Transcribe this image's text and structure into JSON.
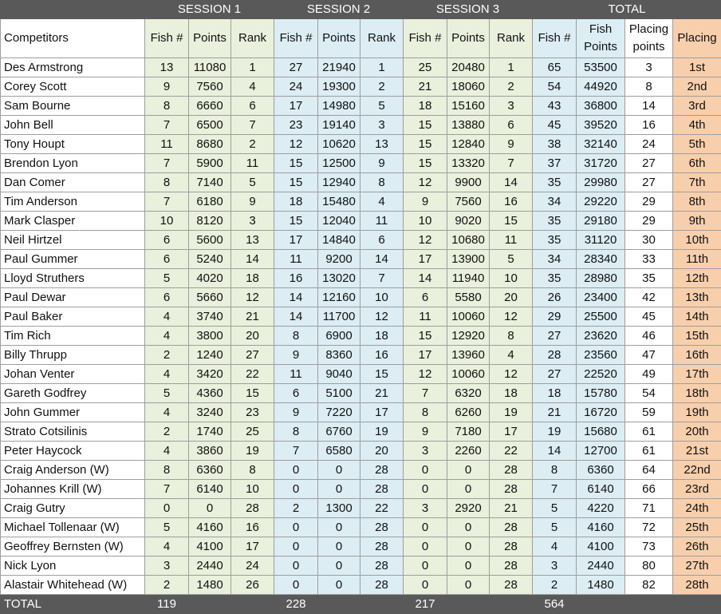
{
  "sessions": [
    "SESSION 1",
    "SESSION 2",
    "SESSION 3",
    "TOTAL"
  ],
  "headers": {
    "competitors": "Competitors",
    "fish": "Fish #",
    "points": "Points",
    "rank": "Rank",
    "total_fish": "Fish #",
    "fish_points": "Fish Points",
    "placing_points": "Placing points",
    "placing": "Placing"
  },
  "rows": [
    {
      "name": "Des Armstrong",
      "s1": [
        "13",
        "11080",
        "1"
      ],
      "s2": [
        "27",
        "21940",
        "1"
      ],
      "s3": [
        "25",
        "20480",
        "1"
      ],
      "total": [
        "65",
        "53500",
        "3",
        "1st"
      ]
    },
    {
      "name": "Corey Scott",
      "s1": [
        "9",
        "7560",
        "4"
      ],
      "s2": [
        "24",
        "19300",
        "2"
      ],
      "s3": [
        "21",
        "18060",
        "2"
      ],
      "total": [
        "54",
        "44920",
        "8",
        "2nd"
      ]
    },
    {
      "name": "Sam Bourne",
      "s1": [
        "8",
        "6660",
        "6"
      ],
      "s2": [
        "17",
        "14980",
        "5"
      ],
      "s3": [
        "18",
        "15160",
        "3"
      ],
      "total": [
        "43",
        "36800",
        "14",
        "3rd"
      ]
    },
    {
      "name": "John Bell",
      "s1": [
        "7",
        "6500",
        "7"
      ],
      "s2": [
        "23",
        "19140",
        "3"
      ],
      "s3": [
        "15",
        "13880",
        "6"
      ],
      "total": [
        "45",
        "39520",
        "16",
        "4th"
      ]
    },
    {
      "name": "Tony Houpt",
      "s1": [
        "11",
        "8680",
        "2"
      ],
      "s2": [
        "12",
        "10620",
        "13"
      ],
      "s3": [
        "15",
        "12840",
        "9"
      ],
      "total": [
        "38",
        "32140",
        "24",
        "5th"
      ]
    },
    {
      "name": "Brendon Lyon",
      "s1": [
        "7",
        "5900",
        "11"
      ],
      "s2": [
        "15",
        "12500",
        "9"
      ],
      "s3": [
        "15",
        "13320",
        "7"
      ],
      "total": [
        "37",
        "31720",
        "27",
        "6th"
      ]
    },
    {
      "name": "Dan Comer",
      "s1": [
        "8",
        "7140",
        "5"
      ],
      "s2": [
        "15",
        "12940",
        "8"
      ],
      "s3": [
        "12",
        "9900",
        "14"
      ],
      "total": [
        "35",
        "29980",
        "27",
        "7th"
      ]
    },
    {
      "name": "Tim Anderson",
      "s1": [
        "7",
        "6180",
        "9"
      ],
      "s2": [
        "18",
        "15480",
        "4"
      ],
      "s3": [
        "9",
        "7560",
        "16"
      ],
      "total": [
        "34",
        "29220",
        "29",
        "8th"
      ]
    },
    {
      "name": "Mark Clasper",
      "s1": [
        "10",
        "8120",
        "3"
      ],
      "s2": [
        "15",
        "12040",
        "11"
      ],
      "s3": [
        "10",
        "9020",
        "15"
      ],
      "total": [
        "35",
        "29180",
        "29",
        "9th"
      ]
    },
    {
      "name": "Neil Hirtzel",
      "s1": [
        "6",
        "5600",
        "13"
      ],
      "s2": [
        "17",
        "14840",
        "6"
      ],
      "s3": [
        "12",
        "10680",
        "11"
      ],
      "total": [
        "35",
        "31120",
        "30",
        "10th"
      ]
    },
    {
      "name": "Paul Gummer",
      "s1": [
        "6",
        "5240",
        "14"
      ],
      "s2": [
        "11",
        "9200",
        "14"
      ],
      "s3": [
        "17",
        "13900",
        "5"
      ],
      "total": [
        "34",
        "28340",
        "33",
        "11th"
      ]
    },
    {
      "name": "Lloyd Struthers",
      "s1": [
        "5",
        "4020",
        "18"
      ],
      "s2": [
        "16",
        "13020",
        "7"
      ],
      "s3": [
        "14",
        "11940",
        "10"
      ],
      "total": [
        "35",
        "28980",
        "35",
        "12th"
      ]
    },
    {
      "name": "Paul Dewar",
      "s1": [
        "6",
        "5660",
        "12"
      ],
      "s2": [
        "14",
        "12160",
        "10"
      ],
      "s3": [
        "6",
        "5580",
        "20"
      ],
      "total": [
        "26",
        "23400",
        "42",
        "13th"
      ]
    },
    {
      "name": "Paul Baker",
      "s1": [
        "4",
        "3740",
        "21"
      ],
      "s2": [
        "14",
        "11700",
        "12"
      ],
      "s3": [
        "11",
        "10060",
        "12"
      ],
      "total": [
        "29",
        "25500",
        "45",
        "14th"
      ]
    },
    {
      "name": "Tim Rich",
      "s1": [
        "4",
        "3800",
        "20"
      ],
      "s2": [
        "8",
        "6900",
        "18"
      ],
      "s3": [
        "15",
        "12920",
        "8"
      ],
      "total": [
        "27",
        "23620",
        "46",
        "15th"
      ]
    },
    {
      "name": "Billy Thrupp",
      "s1": [
        "2",
        "1240",
        "27"
      ],
      "s2": [
        "9",
        "8360",
        "16"
      ],
      "s3": [
        "17",
        "13960",
        "4"
      ],
      "total": [
        "28",
        "23560",
        "47",
        "16th"
      ]
    },
    {
      "name": "Johan Venter",
      "s1": [
        "4",
        "3420",
        "22"
      ],
      "s2": [
        "11",
        "9040",
        "15"
      ],
      "s3": [
        "12",
        "10060",
        "12"
      ],
      "total": [
        "27",
        "22520",
        "49",
        "17th"
      ]
    },
    {
      "name": "Gareth Godfrey",
      "s1": [
        "5",
        "4360",
        "15"
      ],
      "s2": [
        "6",
        "5100",
        "21"
      ],
      "s3": [
        "7",
        "6320",
        "18"
      ],
      "total": [
        "18",
        "15780",
        "54",
        "18th"
      ]
    },
    {
      "name": "John Gummer",
      "s1": [
        "4",
        "3240",
        "23"
      ],
      "s2": [
        "9",
        "7220",
        "17"
      ],
      "s3": [
        "8",
        "6260",
        "19"
      ],
      "total": [
        "21",
        "16720",
        "59",
        "19th"
      ]
    },
    {
      "name": "Strato Cotsilinis",
      "s1": [
        "2",
        "1740",
        "25"
      ],
      "s2": [
        "8",
        "6760",
        "19"
      ],
      "s3": [
        "9",
        "7180",
        "17"
      ],
      "total": [
        "19",
        "15680",
        "61",
        "20th"
      ]
    },
    {
      "name": "Peter Haycock",
      "s1": [
        "4",
        "3860",
        "19"
      ],
      "s2": [
        "7",
        "6580",
        "20"
      ],
      "s3": [
        "3",
        "2260",
        "22"
      ],
      "total": [
        "14",
        "12700",
        "61",
        "21st"
      ]
    },
    {
      "name": "Craig Anderson (W)",
      "s1": [
        "8",
        "6360",
        "8"
      ],
      "s2": [
        "0",
        "0",
        "28"
      ],
      "s3": [
        "0",
        "0",
        "28"
      ],
      "total": [
        "8",
        "6360",
        "64",
        "22nd"
      ]
    },
    {
      "name": "Johannes Krill (W)",
      "s1": [
        "7",
        "6140",
        "10"
      ],
      "s2": [
        "0",
        "0",
        "28"
      ],
      "s3": [
        "0",
        "0",
        "28"
      ],
      "total": [
        "7",
        "6140",
        "66",
        "23rd"
      ]
    },
    {
      "name": "Craig Gutry",
      "s1": [
        "0",
        "0",
        "28"
      ],
      "s2": [
        "2",
        "1300",
        "22"
      ],
      "s3": [
        "3",
        "2920",
        "21"
      ],
      "total": [
        "5",
        "4220",
        "71",
        "24th"
      ]
    },
    {
      "name": "Michael Tollenaar (W)",
      "s1": [
        "5",
        "4160",
        "16"
      ],
      "s2": [
        "0",
        "0",
        "28"
      ],
      "s3": [
        "0",
        "0",
        "28"
      ],
      "total": [
        "5",
        "4160",
        "72",
        "25th"
      ]
    },
    {
      "name": "Geoffrey Bernsten (W)",
      "s1": [
        "4",
        "4100",
        "17"
      ],
      "s2": [
        "0",
        "0",
        "28"
      ],
      "s3": [
        "0",
        "0",
        "28"
      ],
      "total": [
        "4",
        "4100",
        "73",
        "26th"
      ]
    },
    {
      "name": "Nick Lyon",
      "s1": [
        "3",
        "2440",
        "24"
      ],
      "s2": [
        "0",
        "0",
        "28"
      ],
      "s3": [
        "0",
        "0",
        "28"
      ],
      "total": [
        "3",
        "2440",
        "80",
        "27th"
      ]
    },
    {
      "name": "Alastair Whitehead (W)",
      "s1": [
        "2",
        "1480",
        "26"
      ],
      "s2": [
        "0",
        "0",
        "28"
      ],
      "s3": [
        "0",
        "0",
        "28"
      ],
      "total": [
        "2",
        "1480",
        "82",
        "28th"
      ]
    }
  ],
  "total_row": {
    "label": "TOTAL",
    "s1_fish": "119",
    "s2_fish": "228",
    "s3_fish": "217",
    "total_fish": "564"
  },
  "colors": {
    "header_dark": "#595959",
    "session1_green": "#e9f0dc",
    "session2_blue": "#dcedf4",
    "placing_peach": "#f8cfac"
  }
}
